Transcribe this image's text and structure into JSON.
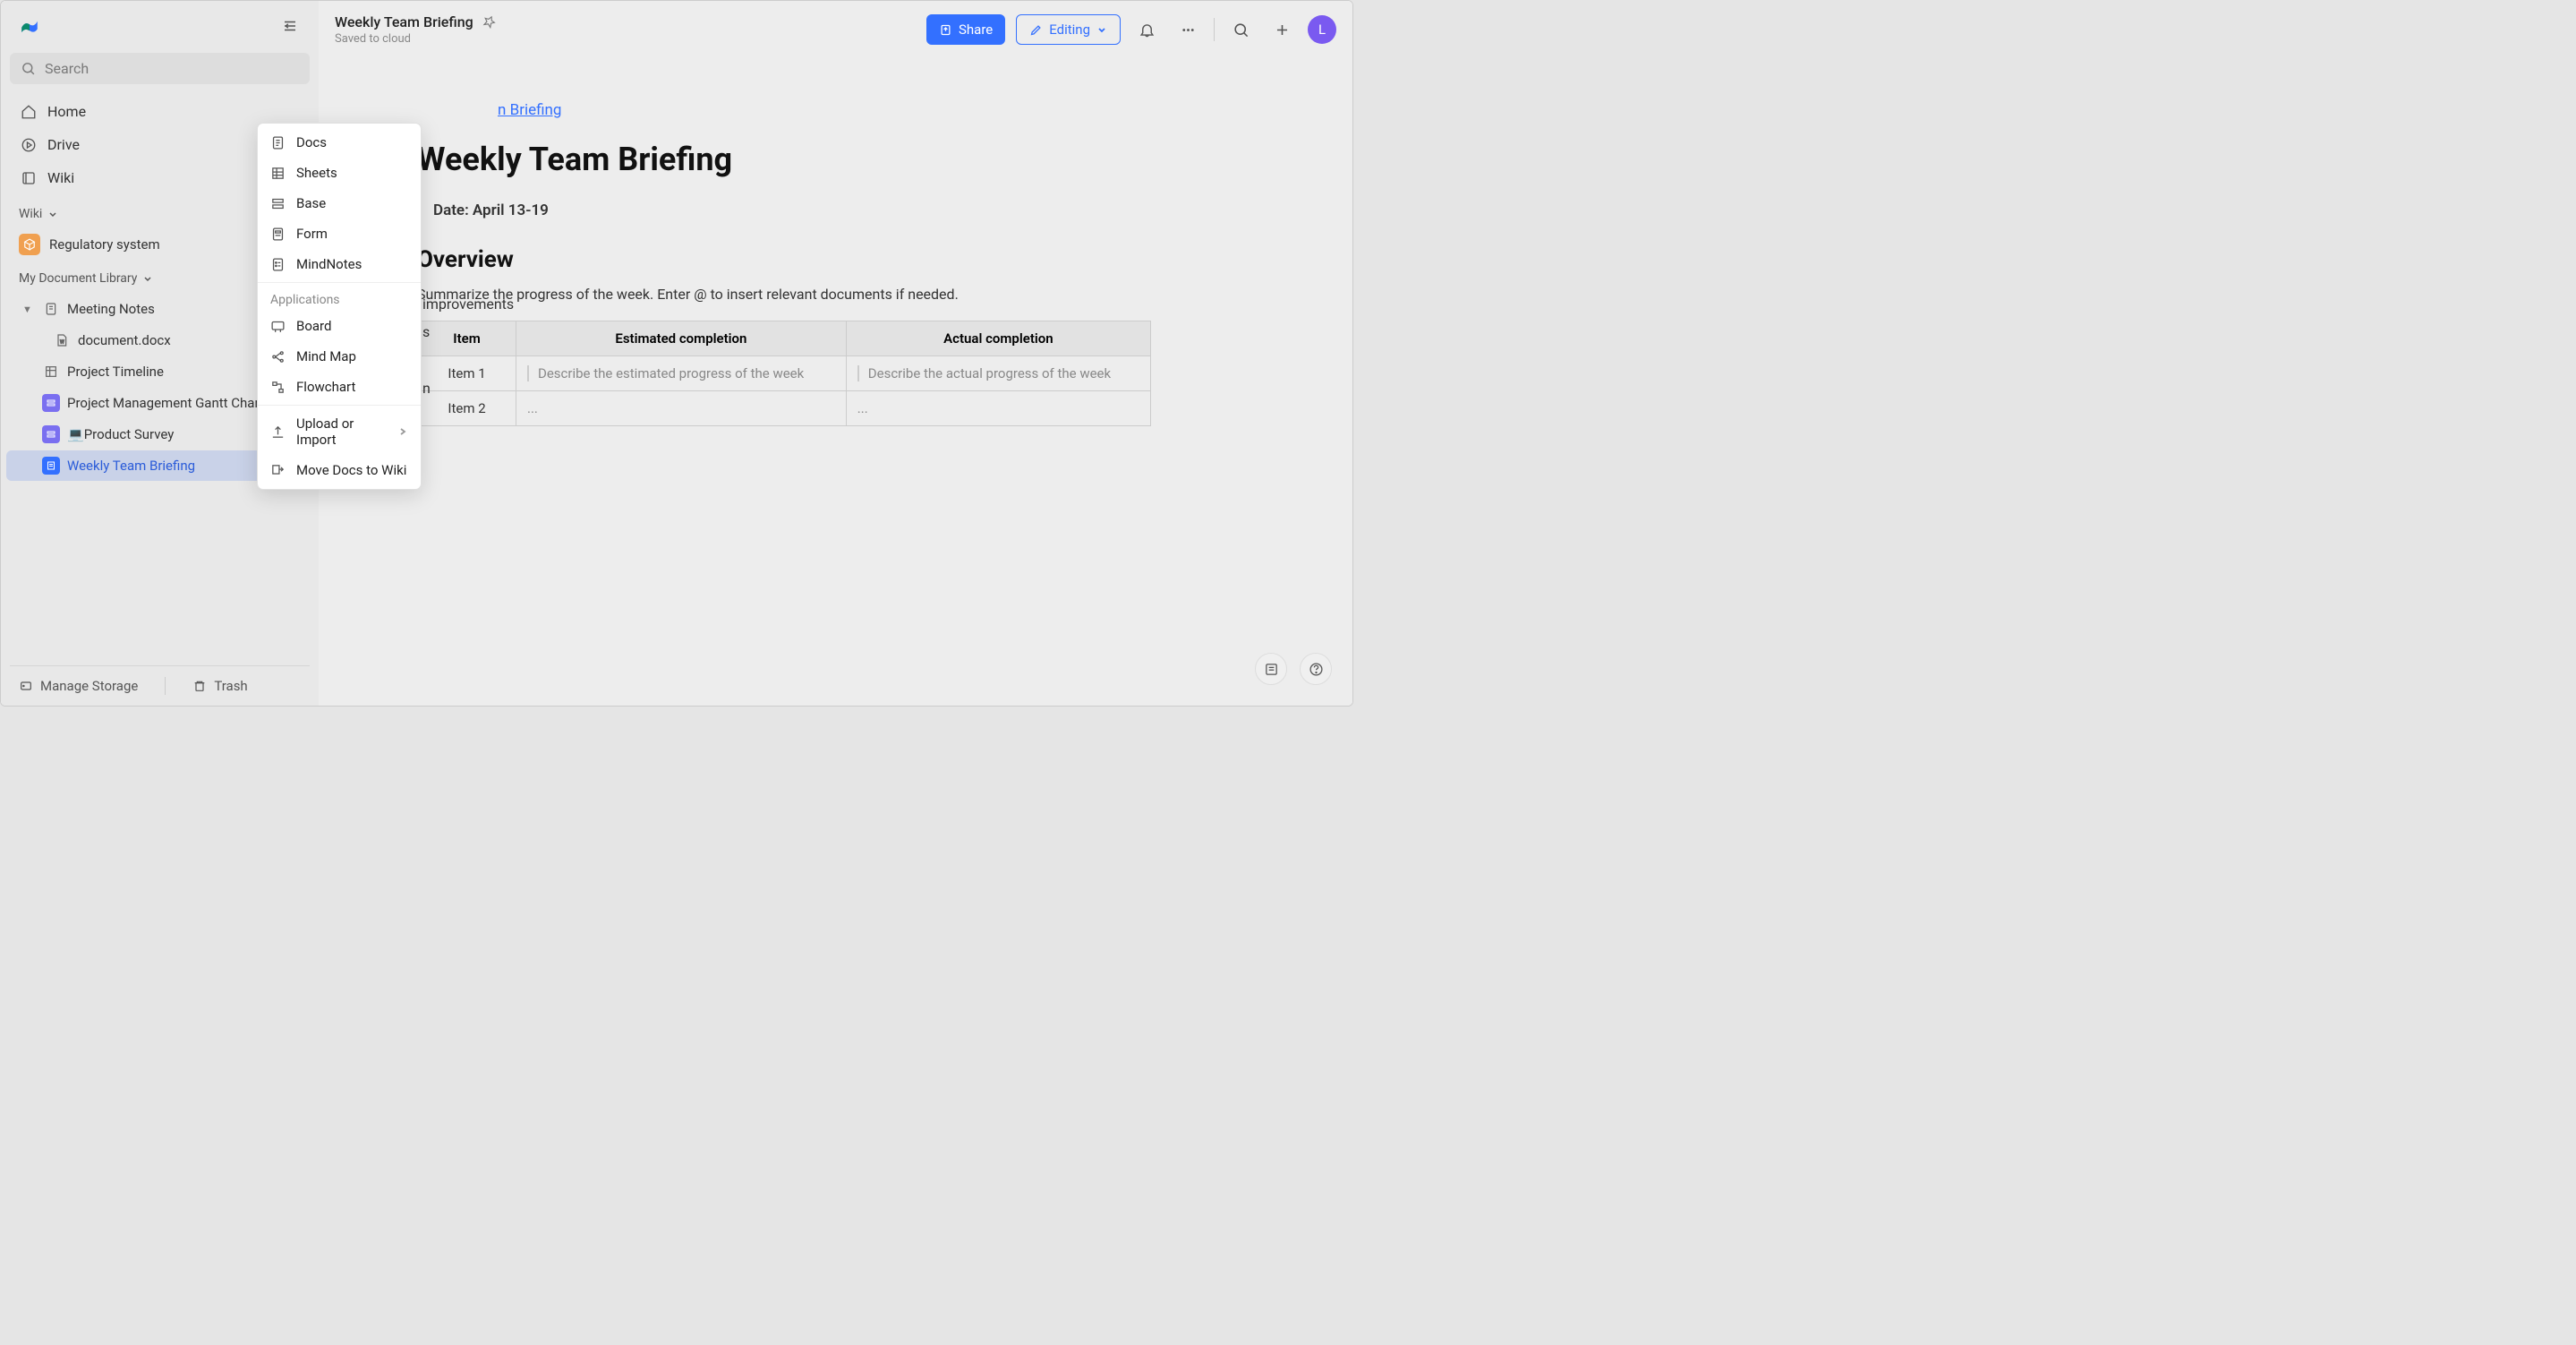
{
  "sidebar": {
    "search_placeholder": "Search",
    "nav": {
      "home": "Home",
      "drive": "Drive",
      "wiki": "Wiki"
    },
    "wiki_section": "Wiki",
    "regulatory": "Regulatory system",
    "library_section": "My Document Library",
    "tree": {
      "meeting_notes": "Meeting Notes",
      "document_docx": "document.docx",
      "project_timeline": "Project Timeline",
      "gantt": "Project Management Gantt Chart",
      "survey_prefix": "💻",
      "survey": "Product Survey",
      "weekly": "Weekly Team Briefing"
    },
    "footer": {
      "manage": "Manage Storage",
      "trash": "Trash"
    }
  },
  "topbar": {
    "title": "Weekly Team Briefing",
    "subtitle": "Saved to cloud",
    "share": "Share",
    "editing": "Editing",
    "avatar": "L"
  },
  "content": {
    "link": "n Briefing",
    "title": "Weekly Team Briefing",
    "date_label": "Date: April 13-19",
    "overview_h": "Overview",
    "overview_body": "Summarize the progress of the week. Enter @ to insert relevant documents if needed.",
    "hint1": "improvements",
    "hint2": "s",
    "hint3": "n",
    "table": {
      "h1": "Item",
      "h2": "Estimated completion",
      "h3": "Actual completion",
      "r1c1": "Item 1",
      "r1c2": "Describe the estimated progress of the week",
      "r1c3": "Describe the actual progress of the week",
      "r2c1": "Item 2",
      "r2c2": "...",
      "r2c3": "..."
    }
  },
  "ctx": {
    "docs": "Docs",
    "sheets": "Sheets",
    "base": "Base",
    "form": "Form",
    "mindnotes": "MindNotes",
    "apps_label": "Applications",
    "board": "Board",
    "mindmap": "Mind Map",
    "flowchart": "Flowchart",
    "upload": "Upload or Import",
    "move": "Move Docs to Wiki"
  }
}
